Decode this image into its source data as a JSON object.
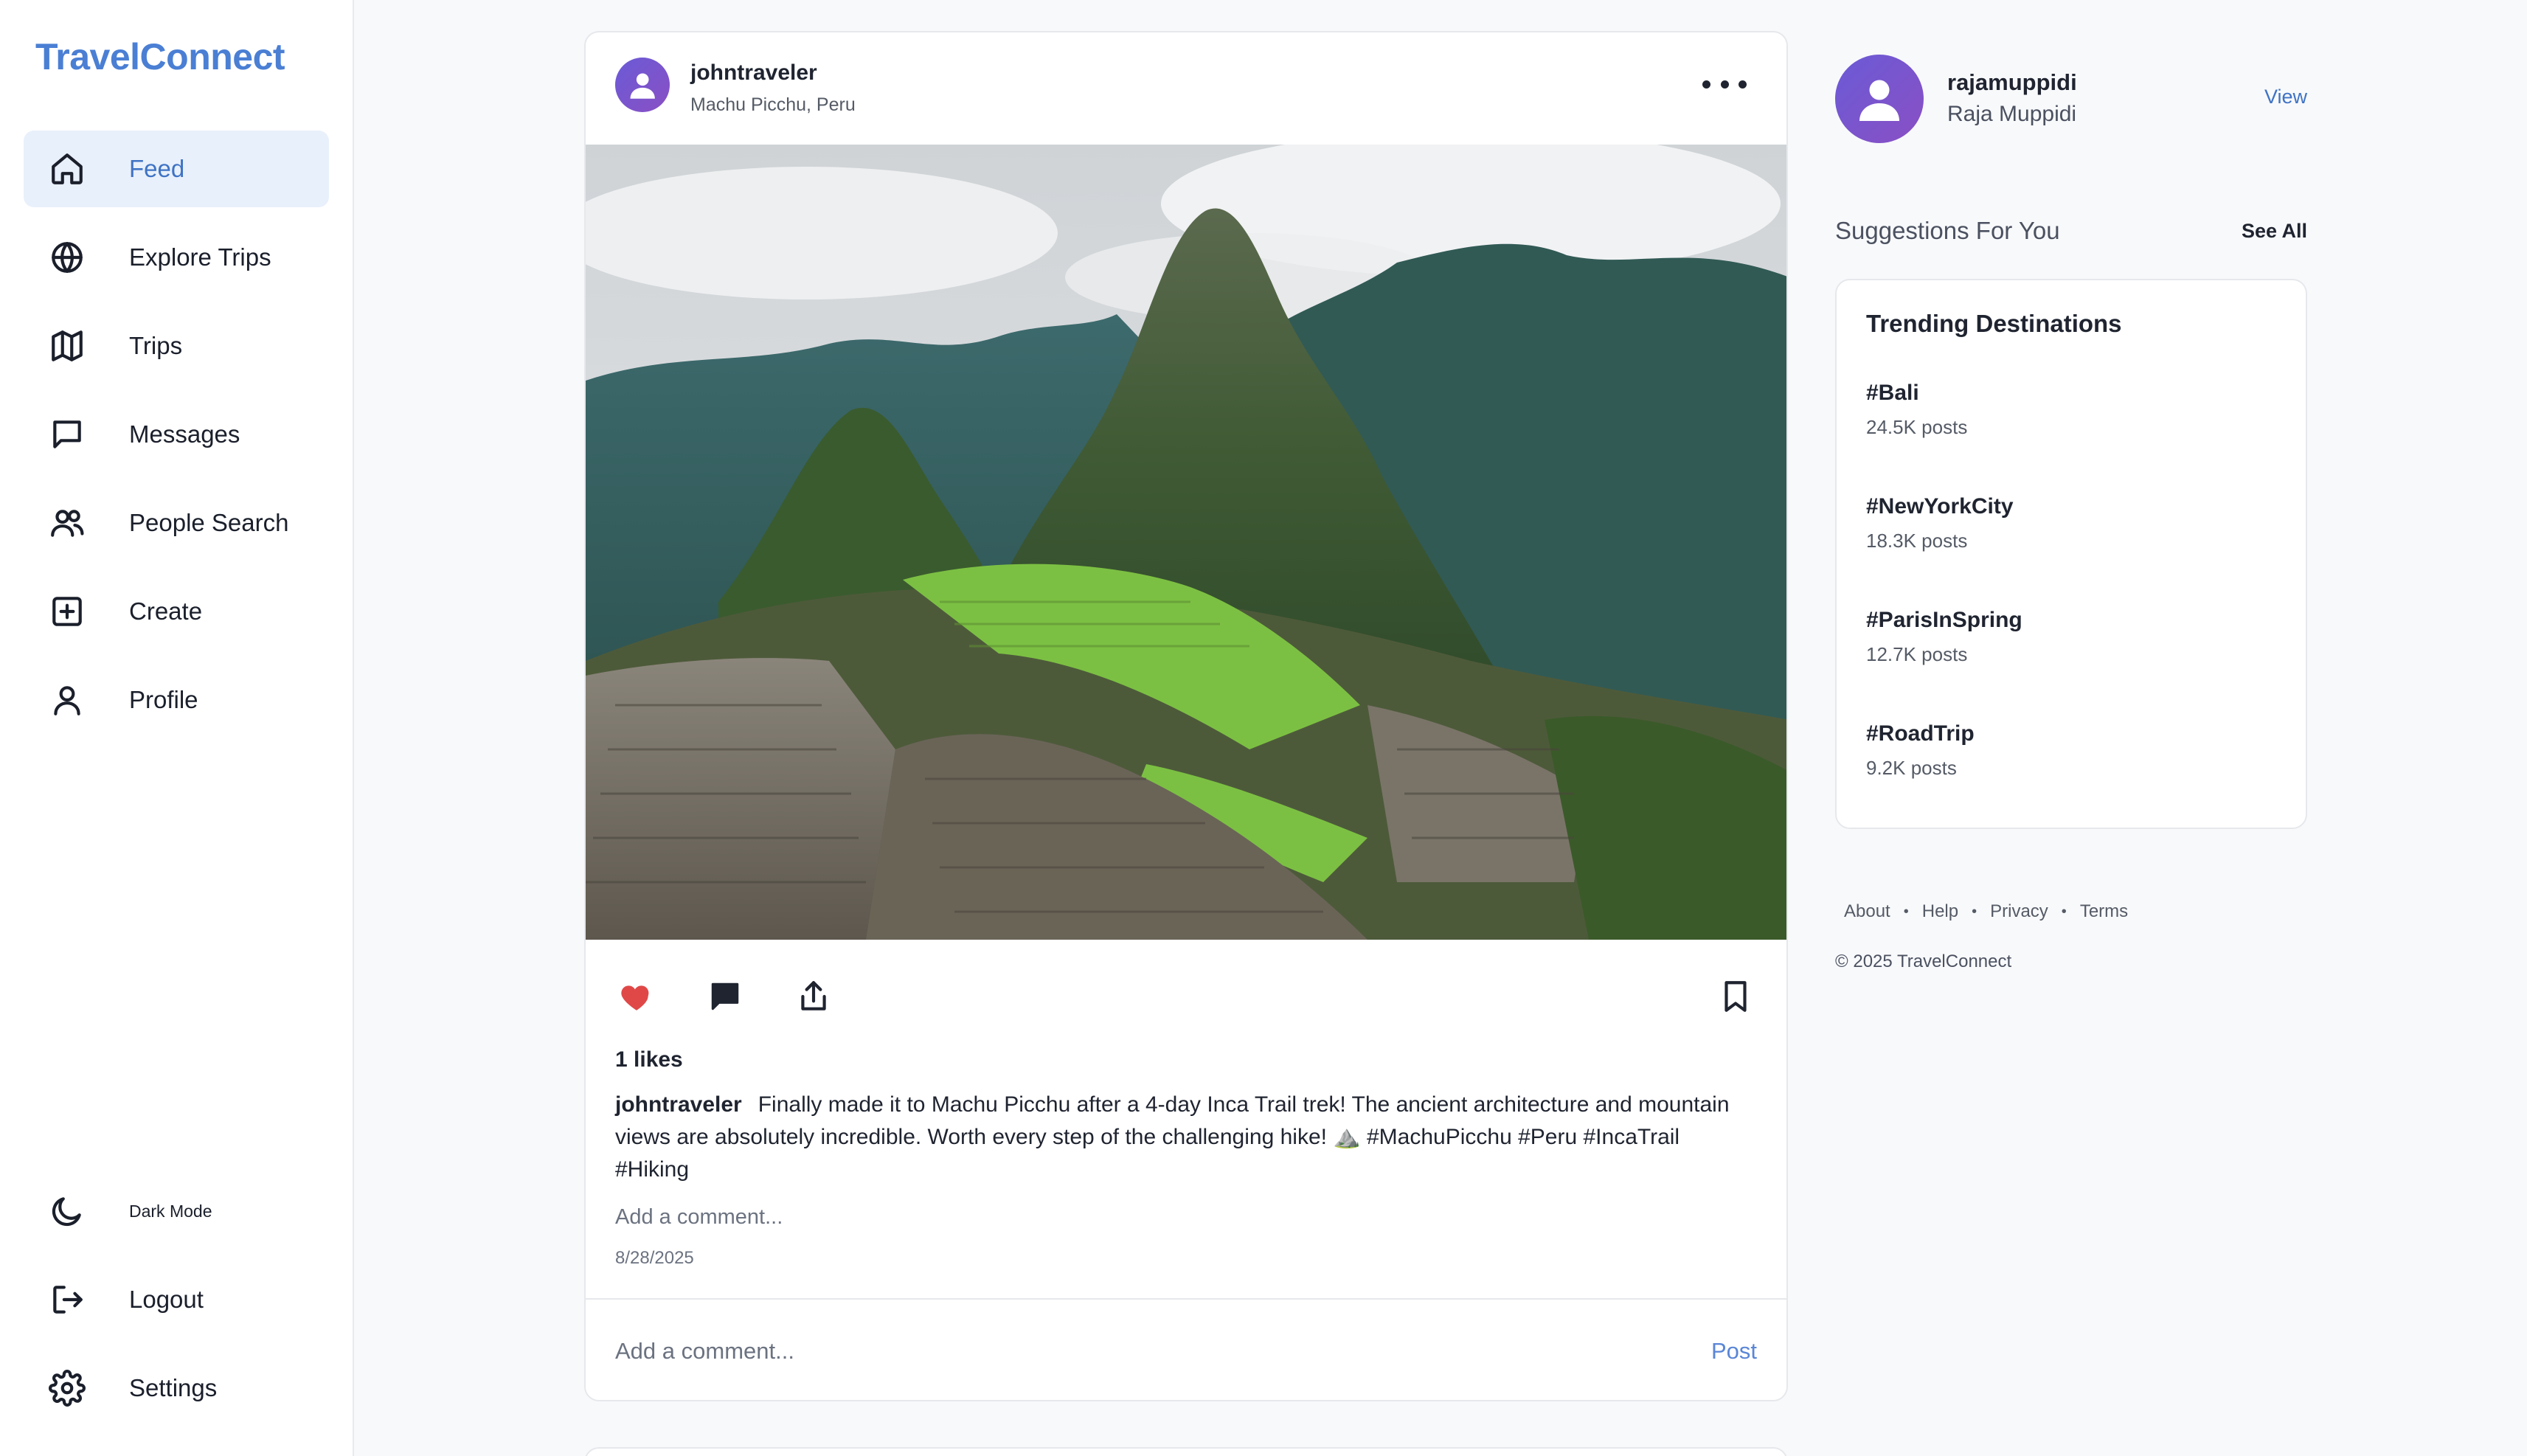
{
  "app": {
    "brand": "TravelConnect"
  },
  "sidebar": {
    "items": [
      {
        "label": "Feed",
        "icon": "home-icon",
        "active": true
      },
      {
        "label": "Explore Trips",
        "icon": "globe-icon"
      },
      {
        "label": "Trips",
        "icon": "map-icon"
      },
      {
        "label": "Messages",
        "icon": "message-icon"
      },
      {
        "label": "People Search",
        "icon": "users-icon"
      },
      {
        "label": "Create",
        "icon": "plus-square-icon"
      },
      {
        "label": "Profile",
        "icon": "user-icon"
      }
    ],
    "bottom": [
      {
        "label": "Dark Mode",
        "icon": "moon-icon"
      },
      {
        "label": "Logout",
        "icon": "logout-icon"
      },
      {
        "label": "Settings",
        "icon": "gear-icon"
      }
    ]
  },
  "post": {
    "username": "johntraveler",
    "location": "Machu Picchu, Peru",
    "likes": "1 likes",
    "caption_user": "johntraveler",
    "caption_text": "Finally made it to Machu Picchu after a 4-day Inca Trail trek! The ancient architecture and mountain views are absolutely incredible. Worth every step of the challenging hike! ⛰️ #MachuPicchu #Peru #IncaTrail #Hiking",
    "add_comment_link": "Add a comment...",
    "date": "8/28/2025",
    "comment_placeholder": "Add a comment...",
    "post_button": "Post",
    "liked": true,
    "like_color": "#e04848"
  },
  "profile": {
    "username": "rajamuppidi",
    "name": "Raja Muppidi",
    "view_label": "View"
  },
  "suggestions": {
    "title": "Suggestions For You",
    "see_all": "See All"
  },
  "trending": {
    "title": "Trending Destinations",
    "items": [
      {
        "tag": "#Bali",
        "count": "24.5K posts"
      },
      {
        "tag": "#NewYorkCity",
        "count": "18.3K posts"
      },
      {
        "tag": "#ParisInSpring",
        "count": "12.7K posts"
      },
      {
        "tag": "#RoadTrip",
        "count": "9.2K posts"
      }
    ]
  },
  "footer": {
    "links": [
      "About",
      "Help",
      "Privacy",
      "Terms"
    ],
    "copyright": "© 2025 TravelConnect"
  },
  "colors": {
    "accent": "#3f73c4",
    "brand": "#4a7fd4",
    "active_bg": "#e8f0fb"
  }
}
